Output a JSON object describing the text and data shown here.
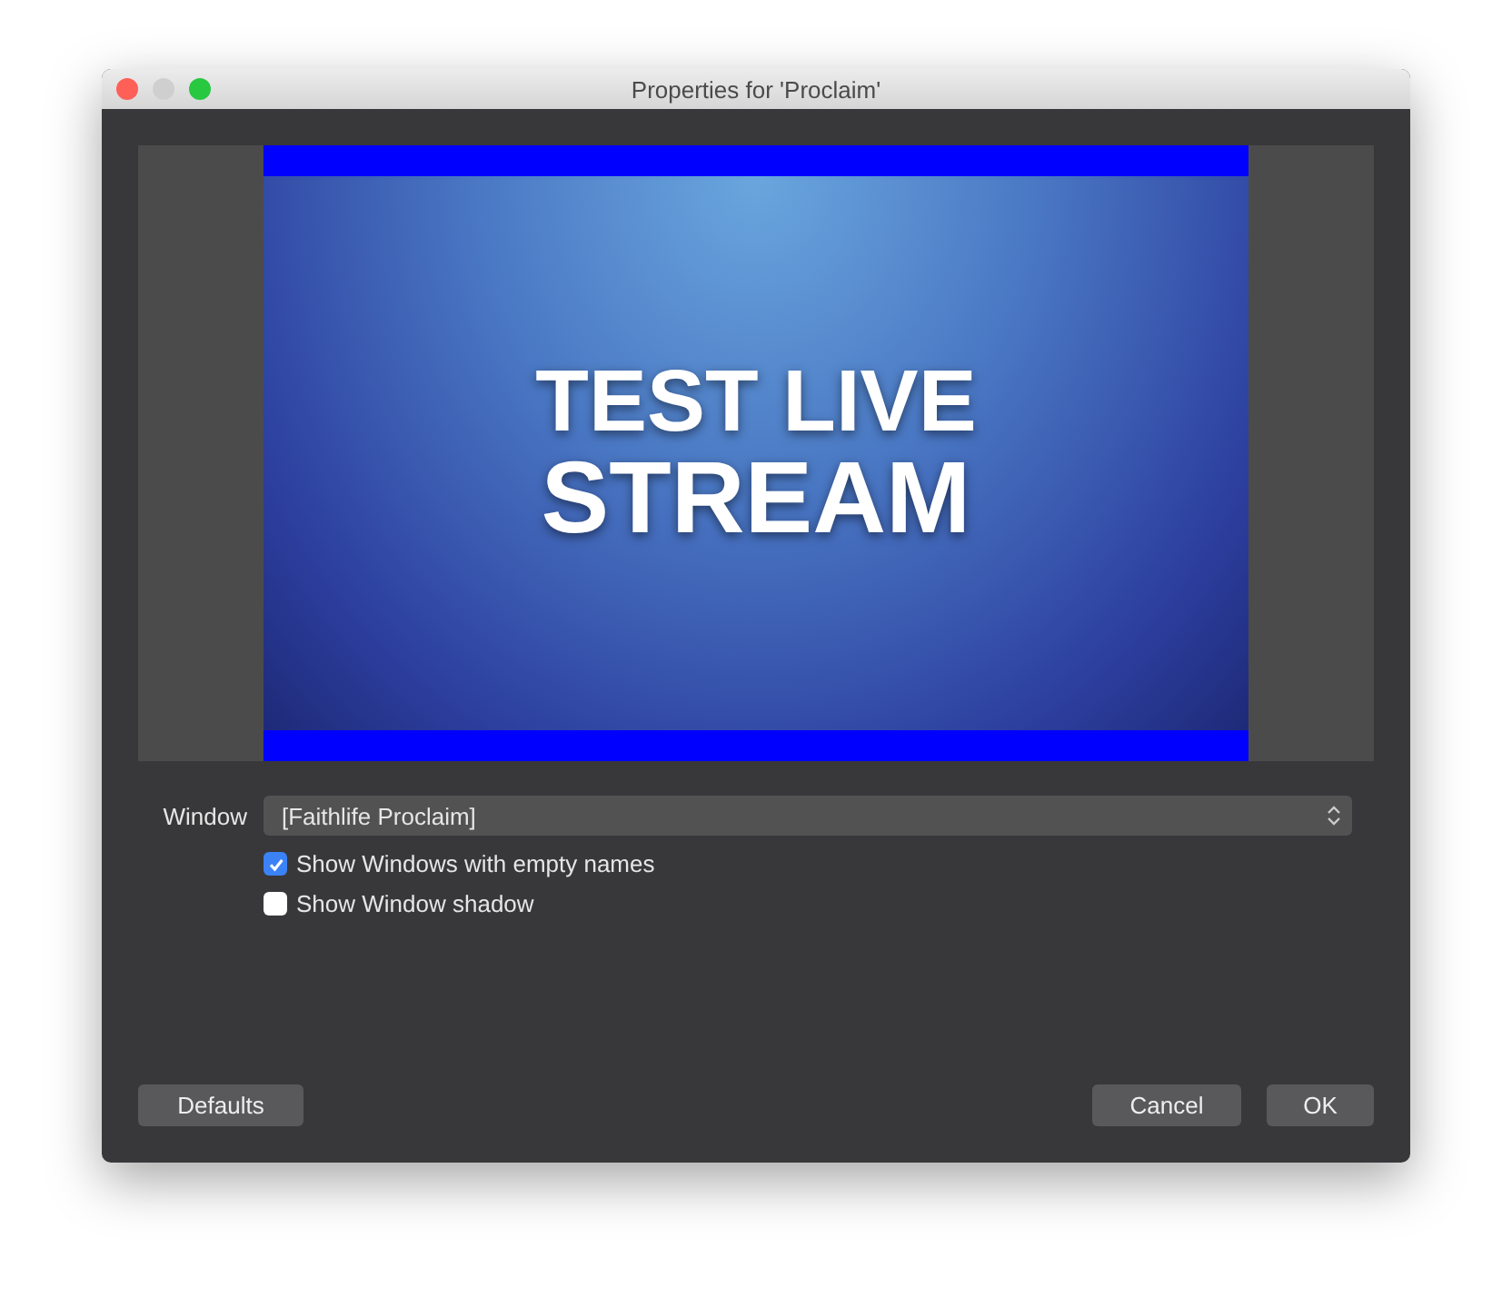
{
  "window": {
    "title": "Properties for 'Proclaim'"
  },
  "preview": {
    "slide_lines": [
      "TEST LIVE",
      "STREAM"
    ]
  },
  "window_field": {
    "label": "Window",
    "value": "[Faithlife Proclaim]"
  },
  "options": [
    {
      "label": "Show Windows with empty names",
      "checked": true
    },
    {
      "label": "Show Window shadow",
      "checked": false
    }
  ],
  "buttons": {
    "left": [
      "Defaults"
    ],
    "right": [
      "Cancel",
      "OK"
    ]
  }
}
